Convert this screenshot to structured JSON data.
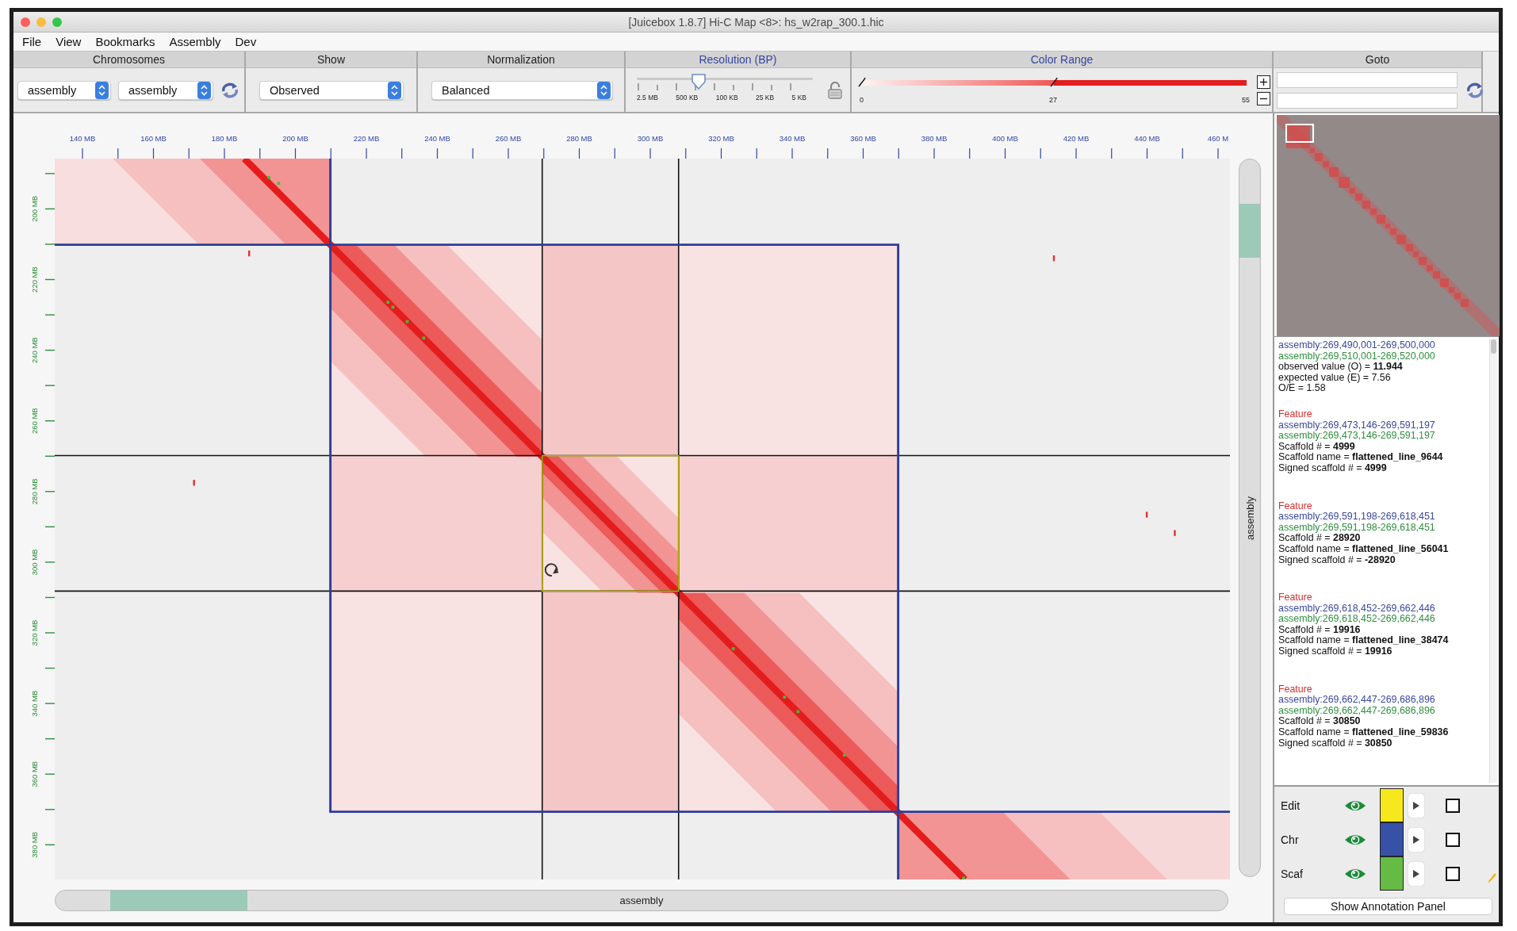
{
  "window": {
    "title": "[Juicebox 1.8.7] Hi-C Map <8>: hs_w2rap_300.1.hic"
  },
  "menu": [
    "File",
    "View",
    "Bookmarks",
    "Assembly",
    "Dev"
  ],
  "toolbar": {
    "chromosomes": {
      "label": "Chromosomes",
      "x_select": "assembly",
      "y_select": "assembly"
    },
    "show": {
      "label": "Show",
      "value": "Observed"
    },
    "normalization": {
      "label": "Normalization",
      "value": "Balanced"
    },
    "resolution": {
      "label": "Resolution (BP)",
      "ticks": [
        "2.5 MB",
        "500 KB",
        "100 KB",
        "25 KB",
        "5 KB"
      ],
      "level": 0.35
    },
    "color_range": {
      "label": "Color Range",
      "min": "0",
      "mid": "27",
      "max": "55",
      "level": 0.5
    },
    "goto": {
      "label": "Goto"
    }
  },
  "map": {
    "x_ticks": [
      "140 MB",
      "160 MB",
      "180 MB",
      "200 MB",
      "220 MB",
      "240 MB",
      "260 MB",
      "280 MB",
      "300 MB",
      "320 MB",
      "340 MB",
      "360 MB",
      "380 MB",
      "400 MB",
      "420 MB",
      "440 MB",
      "460 M"
    ],
    "y_ticks": [
      "200 MB",
      "220 MB",
      "240 MB",
      "260 MB",
      "280 MB",
      "300 MB",
      "320 MB",
      "340 MB",
      "360 MB",
      "380 MB"
    ],
    "y_axis_title": "assembly",
    "x_axis_title": "assembly"
  },
  "info": {
    "x_range": "assembly:269,490,001-269,500,000",
    "y_range": "assembly:269,510,001-269,520,000",
    "values": [
      "observed value (O) = **11.944**",
      "expected value (E) = 7.56",
      "O/E = 1.58"
    ],
    "features": [
      {
        "title": "Feature",
        "x_range": "assembly:269,473,146-269,591,197",
        "y_range": "assembly:269,473,146-269,591,197",
        "lines": [
          "Scaffold # = **4999**",
          "Scaffold name = **flattened_line_9644**",
          "Signed scaffold # = **4999**"
        ]
      },
      {
        "title": "Feature",
        "x_range": "assembly:269,591,198-269,618,451",
        "y_range": "assembly:269,591,198-269,618,451",
        "lines": [
          "Scaffold # = **28920**",
          "Scaffold name = **flattened_line_56041**",
          "Signed scaffold # = **-28920**"
        ]
      },
      {
        "title": "Feature",
        "x_range": "assembly:269,618,452-269,662,446",
        "y_range": "assembly:269,618,452-269,662,446",
        "lines": [
          "Scaffold # = **19916**",
          "Scaffold name = **flattened_line_38474**",
          "Signed scaffold # = **19916**"
        ]
      },
      {
        "title": "Feature",
        "x_range": "assembly:269,662,447-269,686,896",
        "y_range": "assembly:269,662,447-269,686,896",
        "lines": [
          "Scaffold # = **30850**",
          "Scaffold name = **flattened_line_59836**",
          "Signed scaffold # = **30850**"
        ]
      }
    ]
  },
  "layers": [
    {
      "name": "Edit",
      "visible": true,
      "color": "#f7e81e",
      "checked": false
    },
    {
      "name": "Chr",
      "visible": true,
      "color": "#3651a6",
      "checked": false
    },
    {
      "name": "Scaf",
      "visible": true,
      "color": "#66bb44",
      "checked": false
    }
  ],
  "annotation_button": "Show Annotation Panel"
}
